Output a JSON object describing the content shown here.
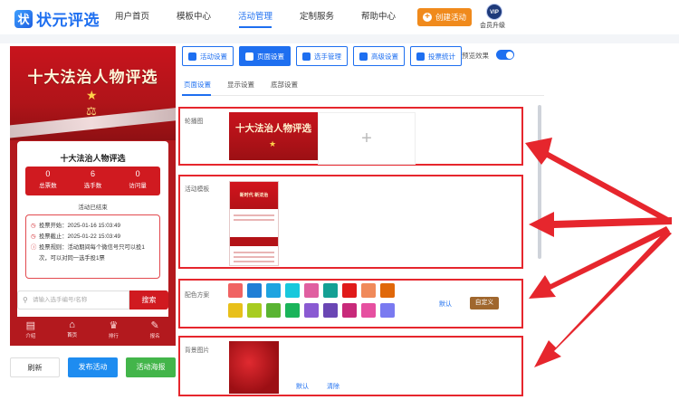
{
  "header": {
    "logo_mark": "状",
    "logo_text": "状元评选",
    "nav": [
      {
        "label": "用户首页"
      },
      {
        "label": "模板中心"
      },
      {
        "label": "活动管理"
      },
      {
        "label": "定制服务"
      },
      {
        "label": "帮助中心"
      }
    ],
    "active_nav": "活动管理",
    "create_label": "创建活动",
    "vip_badge": "VIP",
    "vip_label": "会员升级"
  },
  "phone": {
    "banner_title": "十大法治人物评选",
    "card_title": "十大法治人物评选",
    "stats": [
      {
        "value": "0",
        "label": "总票数"
      },
      {
        "value": "6",
        "label": "选手数"
      },
      {
        "value": "0",
        "label": "访问量"
      }
    ],
    "status": "活动已结束",
    "info": {
      "start": "投票开始：2025-01-16 15:03:49",
      "end": "投票截止：2025-01-22 15:03:49",
      "rule": "投票规则：活动期间每个微信号只可以投1次，可以对同一选手投1票"
    },
    "search_placeholder": "请输入选手编号/名称",
    "search_button": "搜索",
    "tabs": [
      {
        "label": "介绍"
      },
      {
        "label": "首页"
      },
      {
        "label": "排行"
      },
      {
        "label": "报名"
      }
    ]
  },
  "actions": {
    "refresh": "刷新",
    "publish": "发布活动",
    "poster": "活动海报"
  },
  "toolbar": {
    "buttons": [
      {
        "label": "活动设置"
      },
      {
        "label": "页面设置"
      },
      {
        "label": "选手管理"
      },
      {
        "label": "高级设置"
      },
      {
        "label": "投票统计"
      }
    ],
    "active": "页面设置",
    "preview_label": "预览效果",
    "preview_on": true
  },
  "subtabs": [
    {
      "label": "页面设置"
    },
    {
      "label": "显示设置"
    },
    {
      "label": "底部设置"
    }
  ],
  "sections": {
    "carousel": {
      "label": "轮播图",
      "thumb_title": "十大法治人物评选",
      "add": "+"
    },
    "template": {
      "label": "活动模板",
      "thumb_title": "新时代 新法治"
    },
    "colors": {
      "label": "配色方案",
      "palette": [
        "#f06363",
        "#1f7fd6",
        "#1ea4e0",
        "#18c8dc",
        "#e05fa0",
        "#14a094",
        "#e01a1a",
        "#f08a5a",
        "#e0680a",
        "#e8c01a",
        "#a8cc20",
        "#5ab432",
        "#1ab45a",
        "#8a5ad2",
        "#6a46b4",
        "#c82a7a",
        "#e650a0",
        "#7a7af0"
      ],
      "default": "默认",
      "custom": "自定义"
    },
    "background": {
      "label": "背景图片",
      "default": "默认",
      "clear": "清除"
    }
  },
  "colors": {
    "accent": "#1e6ff0",
    "highlight": "#e6262d",
    "brand_red": "#b3191e"
  }
}
